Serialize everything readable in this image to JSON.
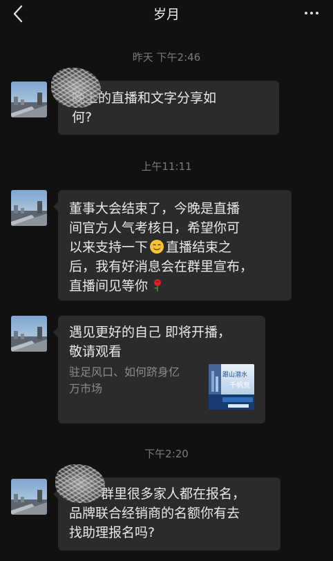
{
  "header": {
    "title": "岁月",
    "back_icon": "chevron-left-icon",
    "more_icon": "more-dots-icon"
  },
  "timestamps": {
    "t1": "昨天 下午2:46",
    "t2": "上午11:11",
    "t3": "下午2:20"
  },
  "messages": [
    {
      "type": "text",
      "text": "晚上的直播和文字分享如\n何?"
    },
    {
      "type": "text",
      "text": "董事大会结束了，今晚是直播\n间官方人气考核日，希望你可\n以来支持一下",
      "emoji1": "smiling-face-icon",
      "text_after_emoji": "直播结束之\n后，我有好消息会在群里宣布，\n直播间见等你",
      "emoji2": "rose-icon"
    },
    {
      "type": "card",
      "title": "遇见更好的自己 即将开播，\n敬请观看",
      "desc": "驻足风口、如何跻身亿\n万市场",
      "thumb_lines": [
        "跟山潜水",
        "千帆竞"
      ]
    },
    {
      "type": "text",
      "text": "群里很多家人都在报名，\n品牌联合经销商的名额你有去\n找助理报名吗?"
    }
  ],
  "colors": {
    "background": "#111111",
    "bubble": "#2b2b2b",
    "text": "#e8e8e8",
    "timestamp": "#7b7b7b"
  }
}
